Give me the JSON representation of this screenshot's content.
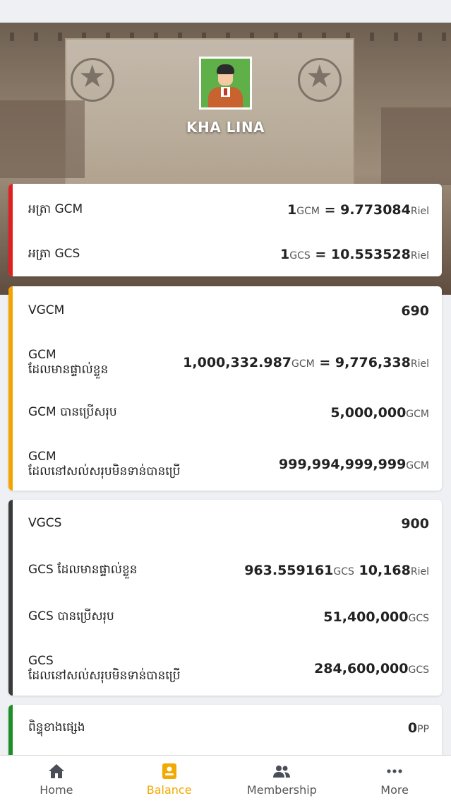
{
  "user": {
    "name": "KHA LINA"
  },
  "rates": {
    "gcm": {
      "label": "អត្រា GCM",
      "amount": "1",
      "unit_from": "GCM",
      "equals": " = ",
      "value": "9.773084",
      "unit_to": "Riel"
    },
    "gcs": {
      "label": "អត្រា GCS",
      "amount": "1",
      "unit_from": "GCS",
      "equals": " = ",
      "value": "10.553528",
      "unit_to": "Riel"
    }
  },
  "gcm_card": {
    "vgcm": {
      "label": "VGCM",
      "value": "690"
    },
    "own": {
      "label_line1": "GCM",
      "label_line2": "ដែលមានផ្ទាល់ខ្លួន",
      "value": "1,000,332.987",
      "unit": "GCM",
      "equals": " = ",
      "riel_value": "9,776,338",
      "riel_unit": "Riel"
    },
    "used": {
      "label": "GCM បានប្រើសរុប",
      "value": "5,000,000",
      "unit": "GCM"
    },
    "remaining": {
      "label_line1": "GCM",
      "label_line2": "ដែលនៅសល់សរុបមិនទាន់បានប្រើ",
      "value": "999,994,999,999",
      "unit": "GCM"
    }
  },
  "gcs_card": {
    "vgcs": {
      "label": "VGCS",
      "value": "900"
    },
    "own": {
      "label": "GCS ដែលមានផ្ទាល់ខ្លួន",
      "value": "963.559161",
      "unit": "GCS",
      "riel_value": "10,168",
      "riel_unit": "Riel"
    },
    "used": {
      "label": "GCS បានប្រើសរុប",
      "value": "51,400,000",
      "unit": "GCS"
    },
    "remaining": {
      "label_line1": "GCS",
      "label_line2": "ដែលនៅសល់សរុបមិនទាន់បានប្រើ",
      "value": "284,600,000",
      "unit": "GCS"
    }
  },
  "points_card": {
    "label": "ពិន្ទុខាងផ្សេង",
    "value": "0",
    "unit": "PP"
  },
  "colors": {
    "gcm_rate_bar": "#e02020",
    "gcm_bar": "#f5a300",
    "gcs_bar": "#3a3a3a",
    "points_bar": "#1e8f28",
    "active_nav": "#f2a900"
  },
  "nav": [
    {
      "label": "Home",
      "icon": "home-icon"
    },
    {
      "label": "Balance",
      "icon": "wallet-icon"
    },
    {
      "label": "Membership",
      "icon": "people-icon"
    },
    {
      "label": "More",
      "icon": "more-dots-icon"
    }
  ]
}
